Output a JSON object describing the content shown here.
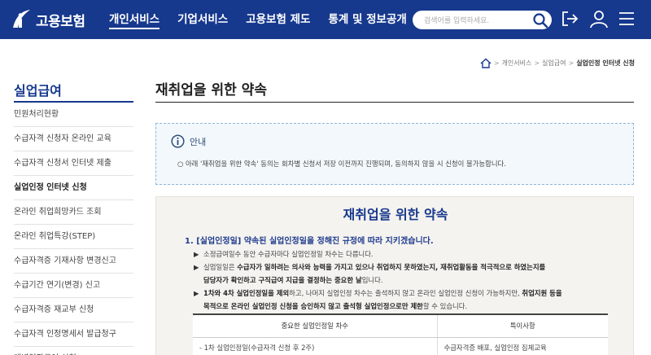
{
  "header": {
    "logo_text": "고용보험",
    "nav": [
      "개인서비스",
      "기업서비스",
      "고용보험 제도",
      "통계 및 정보공개"
    ],
    "search_placeholder": "검색어를 입력하세요."
  },
  "breadcrumb": [
    "개인서비스",
    "실업급여",
    "실업인정 인터넷 신청"
  ],
  "sidebar": {
    "title": "실업급여",
    "items": [
      "민원처리현황",
      "수급자격 신청자 온라인 교육",
      "수급자격 신청서 인터넷 제출",
      "실업인정 인터넷 신청",
      "온라인 취업희망카드 조회",
      "온라인 취업특강(STEP)",
      "수급자격증 기재사항 변경신고",
      "수급기간 연기(변경) 신고",
      "수급자격증 재교부 신청",
      "수급자격 인정명세서 발급청구",
      "개별연장급여 신청"
    ],
    "active_index": 3
  },
  "main": {
    "title": "재취업을 위한 약속",
    "notice_label": "안내",
    "notice_text": "○ 아래 '재취업을 위한 약속' 동의는 회차별 신청서 저장 이전까지 진행되며, 동의하지 않을 시 신청이 불가능합니다.",
    "pledge_title": "재취업을 위한 약속",
    "pledge_heading": "1. [실업인정일] 약속된 실업인정일을 정해진 규정에 따라 지키겠습니다.",
    "bullets": {
      "b1": "소정급여일수 동안 수급자마다 실업인정일 차수는 다릅니다.",
      "b2_a": "실업일일은 ",
      "b2_b": "수급자가 일하려는 의사와 능력을 가지고 있으나 취업하지 못하였는지, 재취업활동을 적극적으로 하였는지를",
      "b2_c": "담당자가 확인하고 구직급여 지급을 결정하는 중요한 날",
      "b2_d": "입니다.",
      "b3_a": "1차와 4차 실업인정일을 제외",
      "b3_b": "하고, 나머지 실업인정 차수는 출석하지 않고 온라인 실업인정 신청이 가능하지만, ",
      "b3_c": "취업지원 등을",
      "b3_d": "목적으로 온라인 실업인정 신청을 승인하지 않고 출석형 실업인정으로만 제한",
      "b3_e": "할 수 있습니다."
    },
    "table": {
      "headers": [
        "중요한 실업인정일 차수",
        "특이사항"
      ],
      "rows": [
        [
          "- 1차 실업인정일(수급자격 신청 후 2주)",
          "수급자격증 배포, 실업인정 집체교육"
        ]
      ]
    }
  }
}
